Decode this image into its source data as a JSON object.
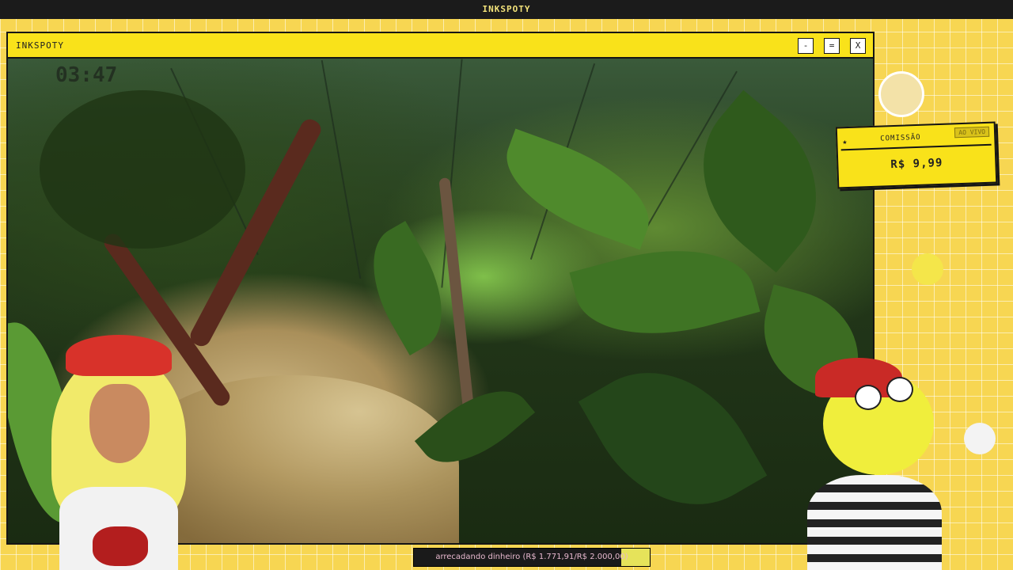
{
  "top_bar": {
    "title": "INKSPOTY"
  },
  "window": {
    "title": "INKSPOTY",
    "buttons": {
      "minimize": "-",
      "maximize": "=",
      "close": "X"
    }
  },
  "scene": {
    "overlay_text": "03:47"
  },
  "commission": {
    "label": "COMISSÃO",
    "badge": "AO VIVO",
    "amount": "R$ 9,99"
  },
  "goal": {
    "text": "arrecadando dinheiro (R$ 1.771,91/R$ 2.000,00)",
    "progress": 0.886
  },
  "colors": {
    "accent": "#f9e21a",
    "background": "#f7d652",
    "dark": "#151515",
    "goal_text": "#e8b9cf"
  },
  "icons": [
    "star-icon",
    "minimize-icon",
    "maximize-icon",
    "close-icon"
  ]
}
